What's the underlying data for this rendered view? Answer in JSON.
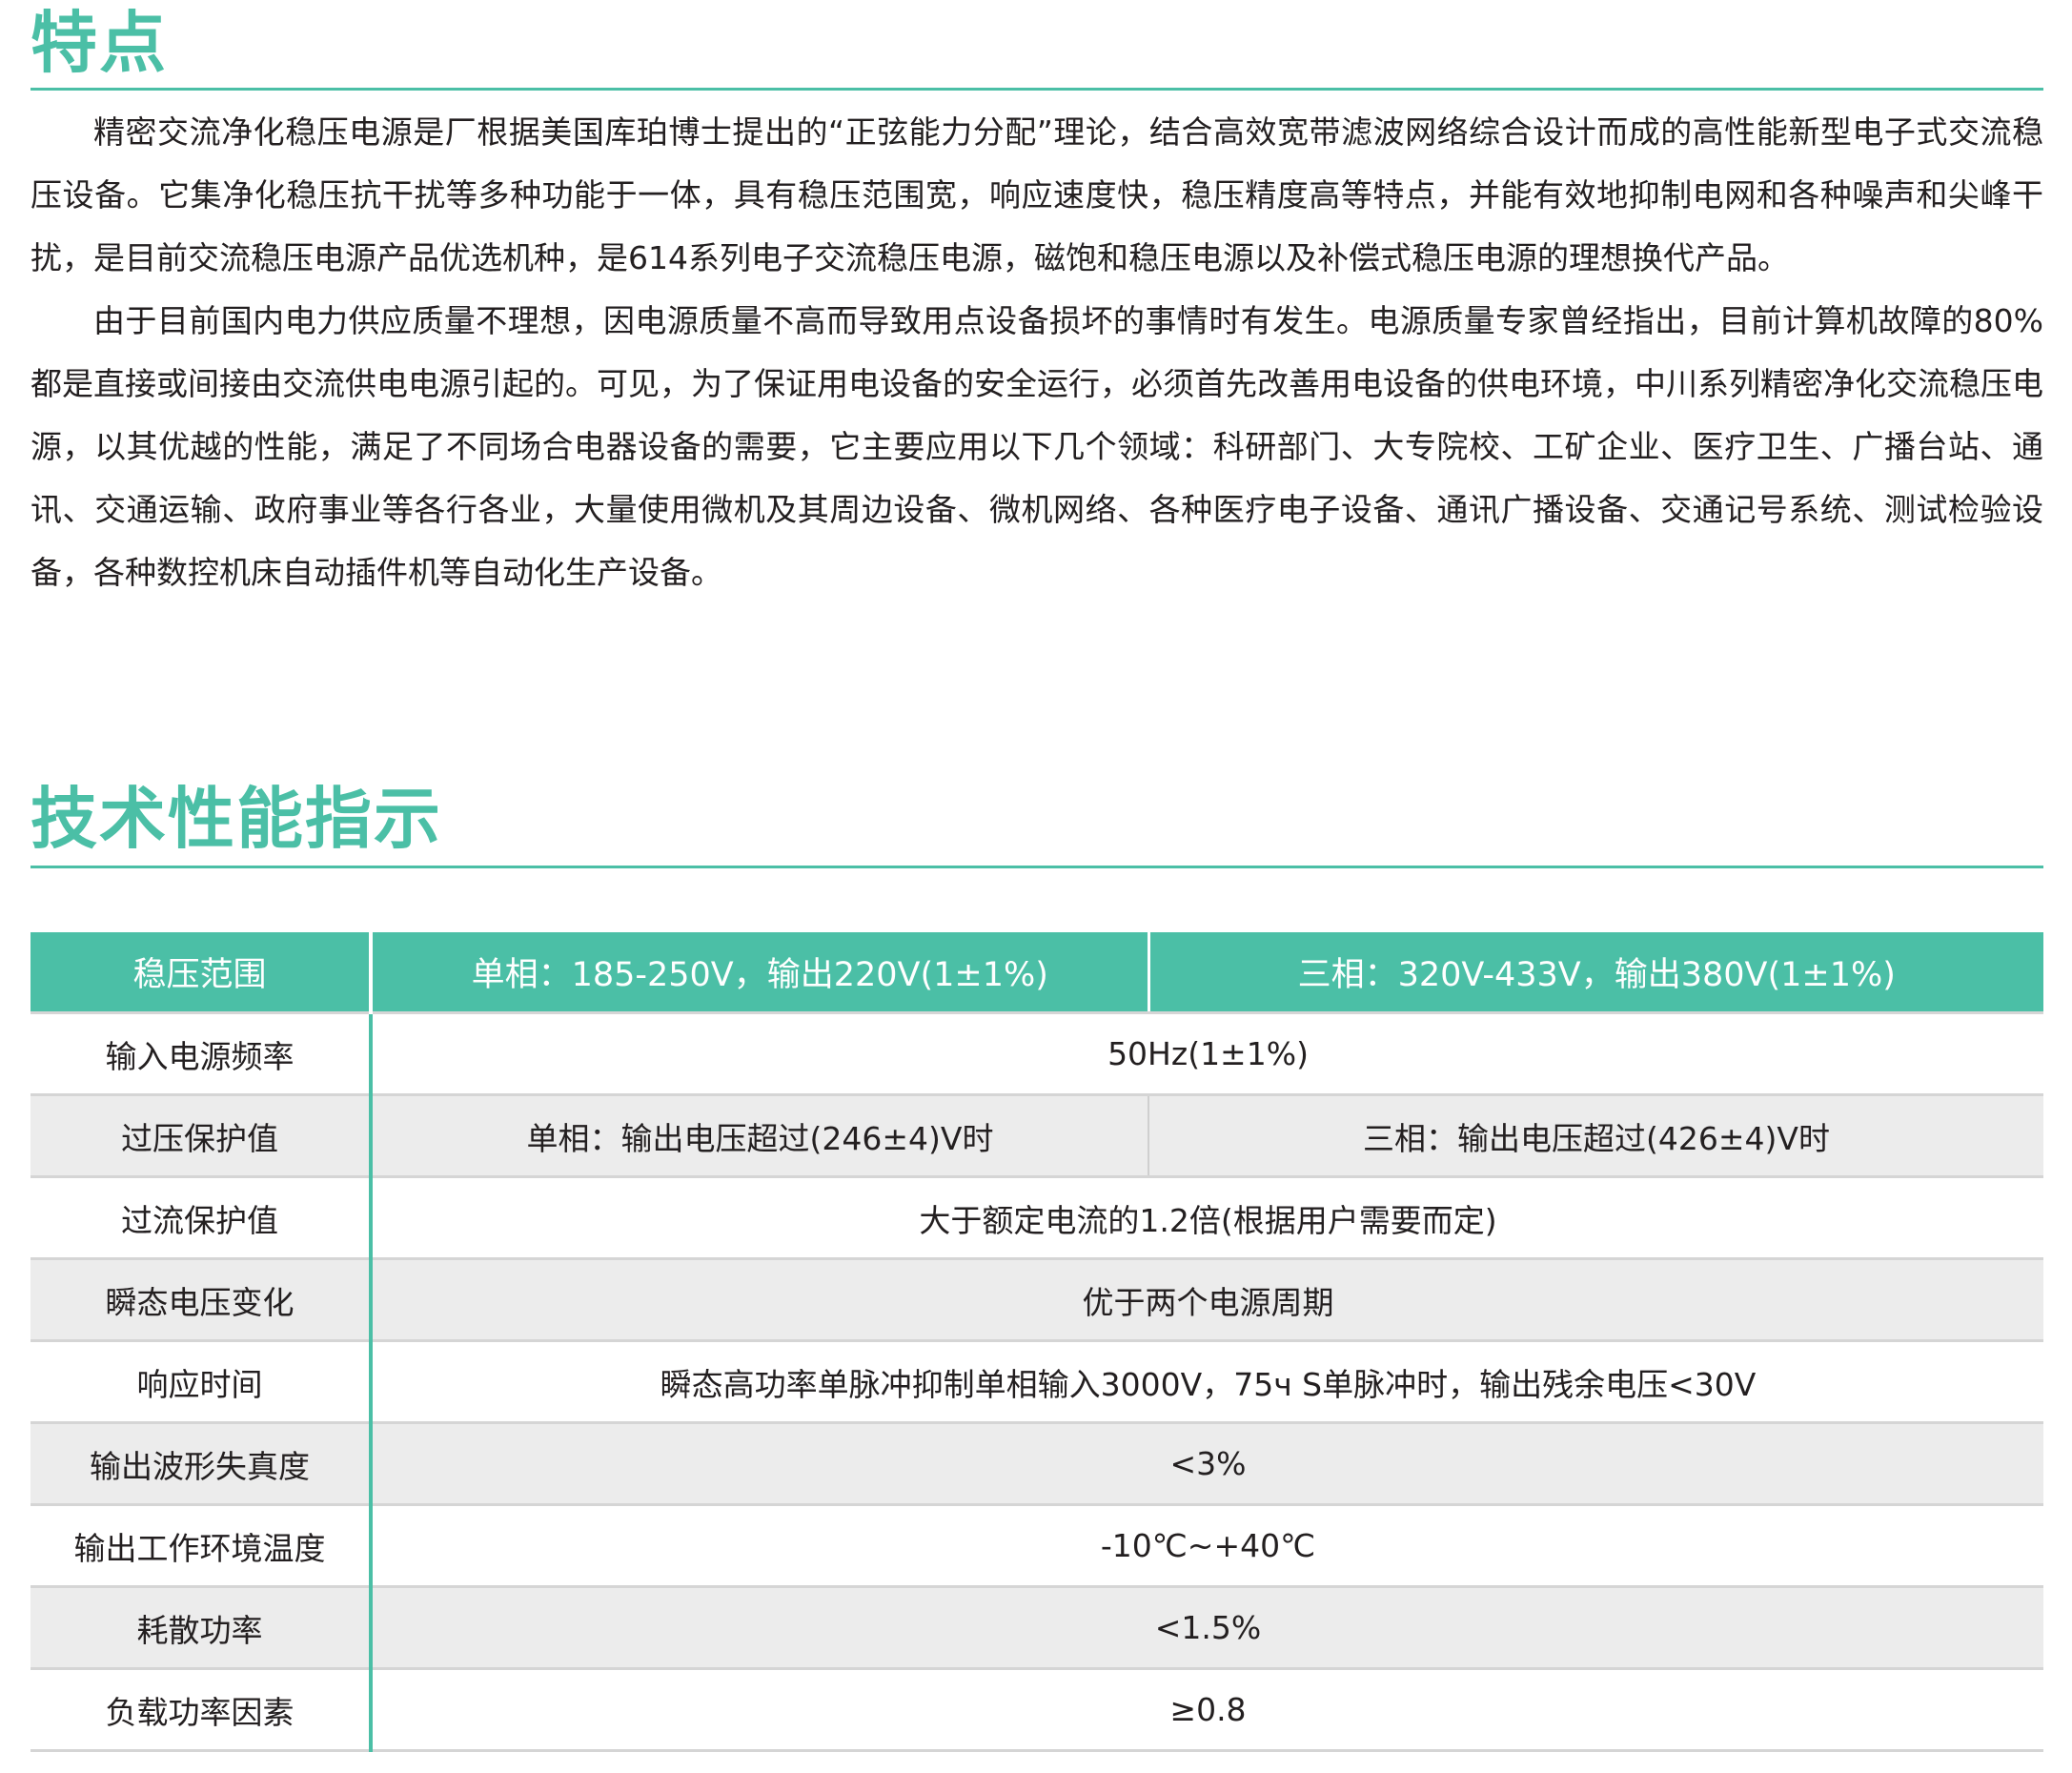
{
  "features": {
    "title": "特点",
    "paragraphs": [
      "精密交流净化稳压电源是厂根据美国库珀博士提出的“正弦能力分配”理论，结合高效宽带滤波网络综合设计而成的高性能新型电子式交流稳压设备。它集净化稳压抗干扰等多种功能于一体，具有稳压范围宽，响应速度快，稳压精度高等特点，并能有效地抑制电网和各种噪声和尖峰干扰，是目前交流稳压电源产品优选机种，是614系列电子交流稳压电源，磁饱和稳压电源以及补偿式稳压电源的理想换代产品。",
      "由于目前国内电力供应质量不理想，因电源质量不高而导致用点设备损坏的事情时有发生。电源质量专家曾经指出，目前计算机故障的80%都是直接或间接由交流供电电源引起的。可见，为了保证用电设备的安全运行，必须首先改善用电设备的供电环境，中川系列精密净化交流稳压电源，以其优越的性能，满足了不同场合电器设备的需要，它主要应用以下几个领域：科研部门、大专院校、工矿企业、医疗卫生、广播台站、通讯、交通运输、政府事业等各行各业，大量使用微机及其周边设备、微机网络、各种医疗电子设备、通讯广播设备、交通记号系统、测试检验设备，各种数控机床自动插件机等自动化生产设备。"
    ]
  },
  "specs": {
    "title": "技术性能指示",
    "header": {
      "label": "稳压范围",
      "single": "单相：185-250V，输出220V(1±1%)",
      "three": "三相：320V-433V，输出380V(1±1%)"
    },
    "rows": [
      {
        "label": "输入电源频率",
        "value": "50Hz(1±1%)"
      },
      {
        "label": "过压保护值",
        "single": "单相：输出电压超过(246±4)V时",
        "three": "三相：输出电压超过(426±4)V时"
      },
      {
        "label": "过流保护值",
        "value": "大于额定电流的1.2倍(根据用户需要而定)"
      },
      {
        "label": "瞬态电压变化",
        "value": "优于两个电源周期"
      },
      {
        "label": "响应时间",
        "value": "瞬态高功率单脉冲抑制单相输入3000V，75ч S单脉冲时，输出残余电压<30V"
      },
      {
        "label": "输出波形失真度",
        "value": "<3%"
      },
      {
        "label": "输出工作环境温度",
        "value": "-10℃~+40℃"
      },
      {
        "label": "耗散功率",
        "value": "<1.5%"
      },
      {
        "label": "负载功率因素",
        "value": "≥0.8"
      }
    ]
  },
  "colors": {
    "accent": "#4bbfa6",
    "row_alt": "#ececec",
    "text": "#231f20"
  }
}
